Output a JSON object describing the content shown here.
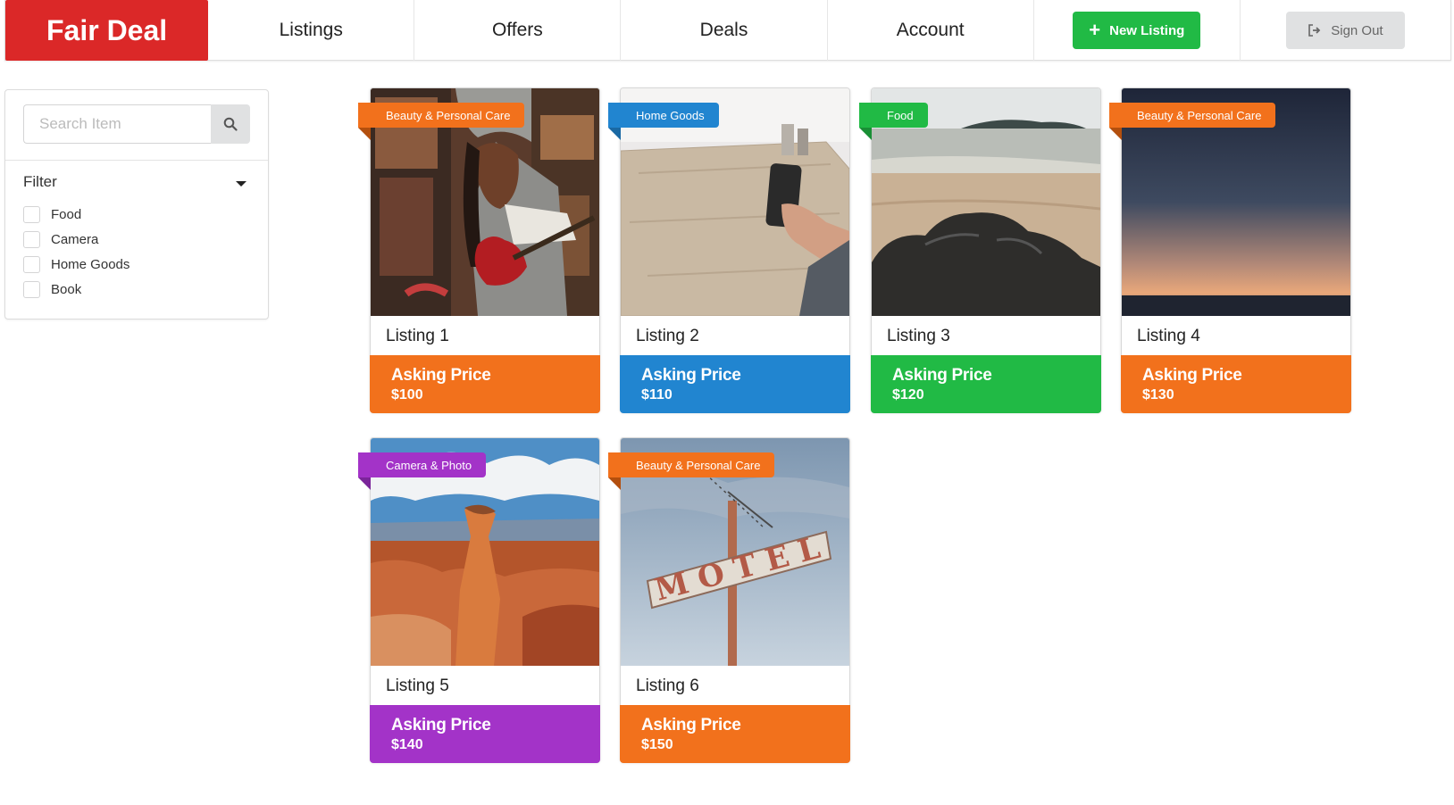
{
  "brand": "Fair Deal",
  "nav": {
    "items": [
      "Listings",
      "Offers",
      "Deals",
      "Account"
    ],
    "new_listing": "New Listing",
    "sign_out": "Sign Out"
  },
  "sidebar": {
    "search_placeholder": "Search Item",
    "filter_title": "Filter",
    "options": [
      "Food",
      "Camera",
      "Home Goods",
      "Book"
    ]
  },
  "listings": [
    {
      "title": "Listing 1",
      "category": "Beauty & Personal Care",
      "price_label": "Asking Price",
      "price": "$100",
      "color": "#f2711c"
    },
    {
      "title": "Listing 2",
      "category": "Home Goods",
      "price_label": "Asking Price",
      "price": "$110",
      "color": "#2185d0"
    },
    {
      "title": "Listing 3",
      "category": "Food",
      "price_label": "Asking Price",
      "price": "$120",
      "color": "#21ba45"
    },
    {
      "title": "Listing 4",
      "category": "Beauty & Personal Care",
      "price_label": "Asking Price",
      "price": "$130",
      "color": "#f2711c"
    },
    {
      "title": "Listing 5",
      "category": "Camera & Photo",
      "price_label": "Asking Price",
      "price": "$140",
      "color": "#a333c8"
    },
    {
      "title": "Listing 6",
      "category": "Beauty & Personal Care",
      "price_label": "Asking Price",
      "price": "$150",
      "color": "#f2711c"
    }
  ]
}
